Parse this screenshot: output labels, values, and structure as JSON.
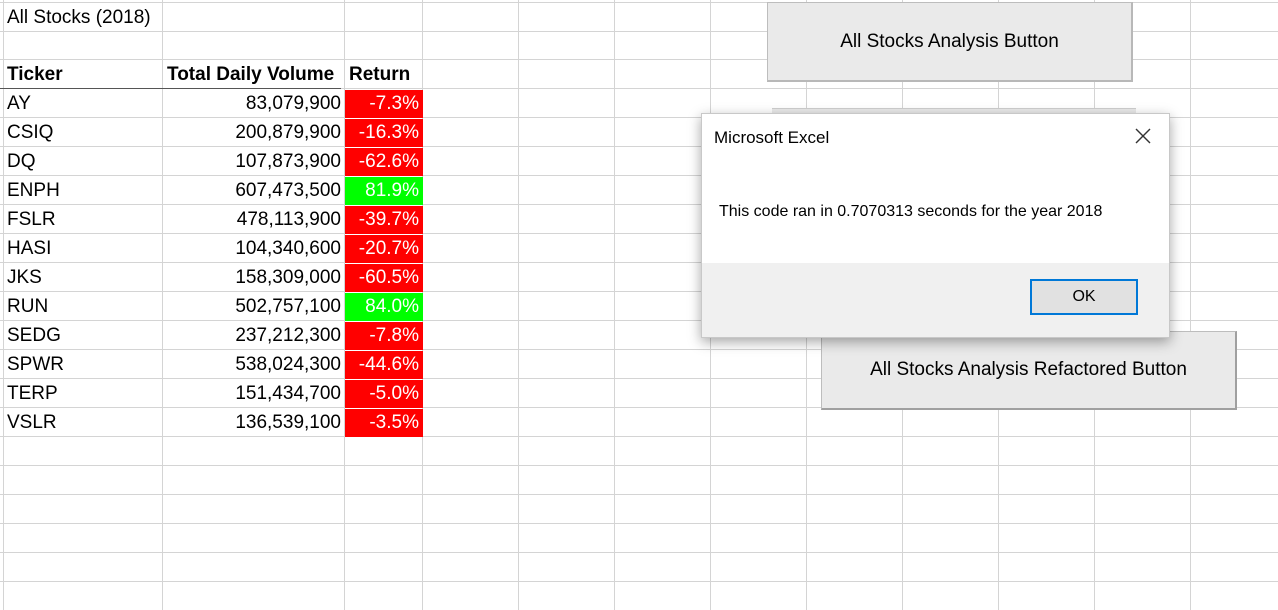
{
  "sheet": {
    "title": "All Stocks (2018)",
    "headers": {
      "ticker": "Ticker",
      "volume": "Total Daily Volume",
      "return": "Return"
    },
    "rows": [
      {
        "ticker": "AY",
        "volume": "83,079,900",
        "return": "-7.3%",
        "status": "negative"
      },
      {
        "ticker": "CSIQ",
        "volume": "200,879,900",
        "return": "-16.3%",
        "status": "negative"
      },
      {
        "ticker": "DQ",
        "volume": "107,873,900",
        "return": "-62.6%",
        "status": "negative"
      },
      {
        "ticker": "ENPH",
        "volume": "607,473,500",
        "return": "81.9%",
        "status": "positive"
      },
      {
        "ticker": "FSLR",
        "volume": "478,113,900",
        "return": "-39.7%",
        "status": "negative"
      },
      {
        "ticker": "HASI",
        "volume": "104,340,600",
        "return": "-20.7%",
        "status": "negative"
      },
      {
        "ticker": "JKS",
        "volume": "158,309,000",
        "return": "-60.5%",
        "status": "negative"
      },
      {
        "ticker": "RUN",
        "volume": "502,757,100",
        "return": "84.0%",
        "status": "positive"
      },
      {
        "ticker": "SEDG",
        "volume": "237,212,300",
        "return": "-7.8%",
        "status": "negative"
      },
      {
        "ticker": "SPWR",
        "volume": "538,024,300",
        "return": "-44.6%",
        "status": "negative"
      },
      {
        "ticker": "TERP",
        "volume": "151,434,700",
        "return": "-5.0%",
        "status": "negative"
      },
      {
        "ticker": "VSLR",
        "volume": "136,539,100",
        "return": "-3.5%",
        "status": "negative"
      }
    ]
  },
  "buttons": {
    "analysis": "All Stocks Analysis Button",
    "refactored": "All Stocks Analysis Refactored Button"
  },
  "dialog": {
    "title": "Microsoft Excel",
    "message": "This code ran in 0.7070313 seconds for the year 2018",
    "ok_label": "OK",
    "close_icon": "close-icon"
  },
  "colors": {
    "negative": "#ff0000",
    "positive": "#00ff00",
    "accent": "#0078d7"
  }
}
